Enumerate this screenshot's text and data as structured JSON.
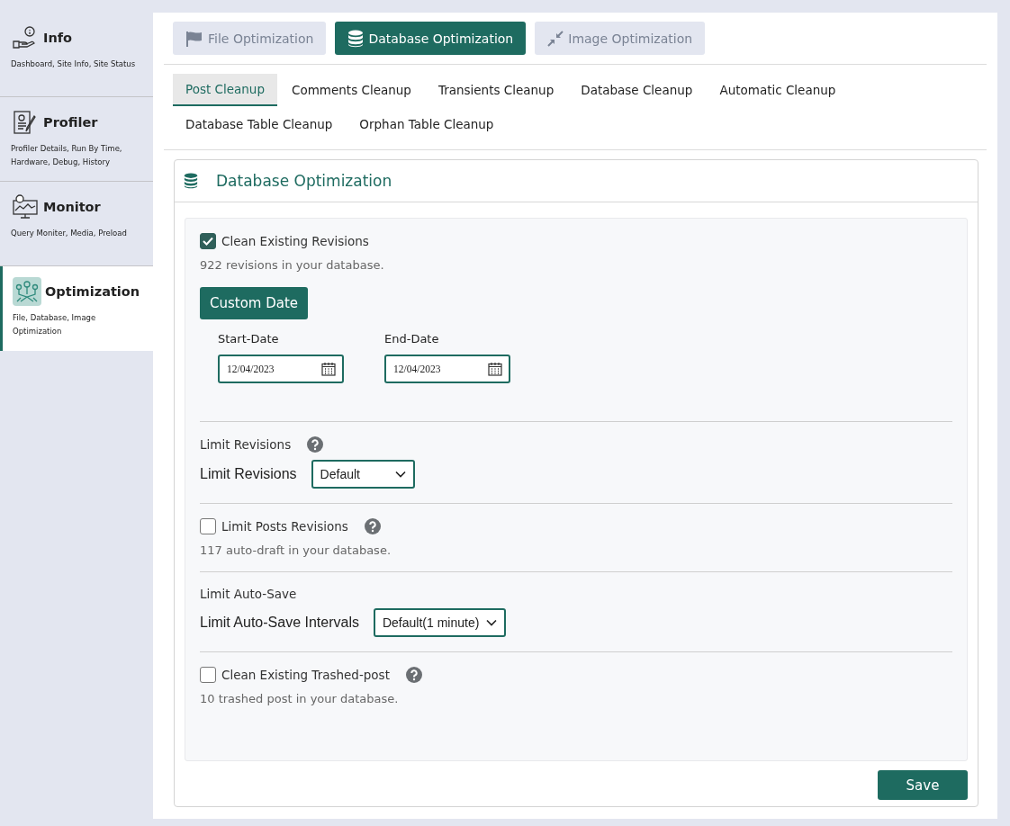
{
  "sidebar": {
    "items": [
      {
        "title": "Info",
        "subtitle": "Dashboard, Site Info, Site Status",
        "selected": false
      },
      {
        "title": "Profiler",
        "subtitle": "Profiler Details, Run By Time, Hardware, Debug, History",
        "selected": false
      },
      {
        "title": "Monitor",
        "subtitle": "Query Moniter, Media, Preload",
        "selected": false
      },
      {
        "title": "Optimization",
        "subtitle": "File, Database, Image Optimization",
        "selected": true
      }
    ]
  },
  "top_tabs": [
    {
      "label": "File Optimization",
      "selected": false
    },
    {
      "label": "Database Optimization",
      "selected": true
    },
    {
      "label": "Image Optimization",
      "selected": false
    }
  ],
  "sub_tabs": [
    {
      "label": "Post Cleanup",
      "selected": true
    },
    {
      "label": "Comments Cleanup",
      "selected": false
    },
    {
      "label": "Transients Cleanup",
      "selected": false
    },
    {
      "label": "Database Cleanup",
      "selected": false
    },
    {
      "label": "Automatic Cleanup",
      "selected": false
    },
    {
      "label": "Database Table Cleanup",
      "selected": false
    },
    {
      "label": "Orphan Table Cleanup",
      "selected": false
    }
  ],
  "card": {
    "title": "Database Optimization",
    "blocks": [
      {
        "kind": "checkbox",
        "label": "Clean Existing Revisions",
        "checked": true,
        "help": false,
        "note": "922 revisions in your database."
      },
      {
        "kind": "button",
        "label": "Custom Date"
      },
      {
        "kind": "dates",
        "fields": [
          {
            "label": "Start-Date",
            "value": "12/04/2023"
          },
          {
            "label": "End-Date",
            "value": "12/04/2023"
          }
        ]
      },
      {
        "kind": "select",
        "heading": "Limit Revisions",
        "help": true,
        "label": "Limit Revisions",
        "value": "Default"
      },
      {
        "kind": "checkbox",
        "label": "Limit Posts Revisions",
        "checked": false,
        "help": true,
        "note": "117 auto-draft in your database."
      },
      {
        "kind": "select",
        "heading": "Limit Auto-Save",
        "help": false,
        "label": "Limit Auto-Save Intervals",
        "value": "Default(1 minute)"
      },
      {
        "kind": "checkbox",
        "label": "Clean Existing Trashed-post",
        "checked": false,
        "help": true,
        "note": "10 trashed post in your database."
      }
    ],
    "save_button": "Save"
  }
}
